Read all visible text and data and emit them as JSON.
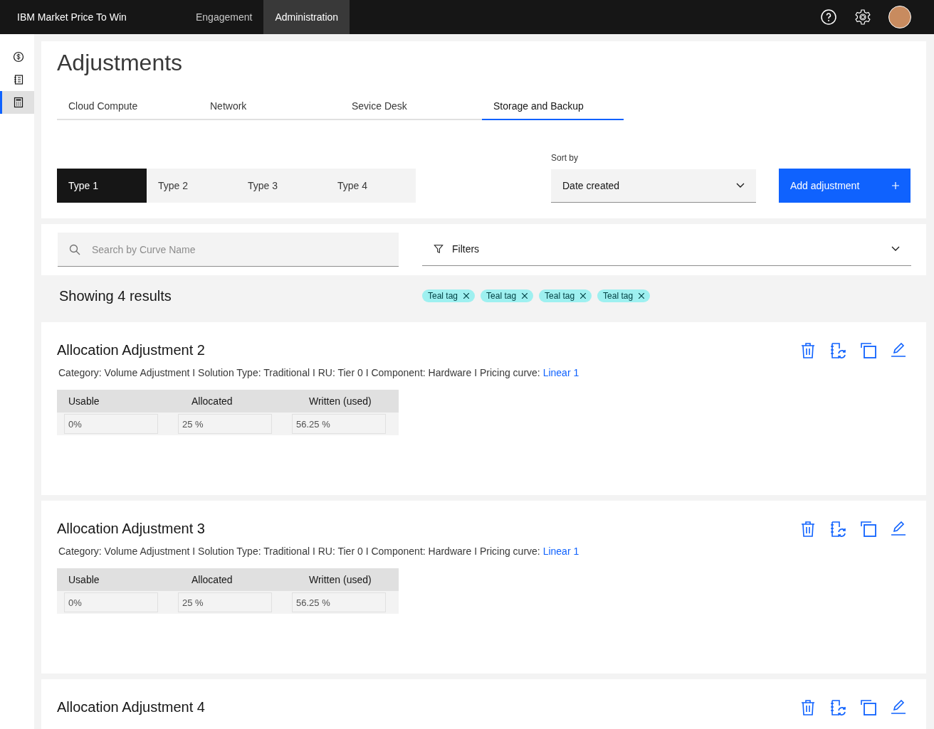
{
  "header": {
    "brand": "IBM Market Price To Win",
    "nav": [
      {
        "label": "Engagement",
        "selected": false
      },
      {
        "label": "Administration",
        "selected": true
      }
    ]
  },
  "sidebar": {
    "items": [
      {
        "kind": "dollar",
        "selected": false
      },
      {
        "kind": "notebook",
        "selected": false
      },
      {
        "kind": "calculator",
        "selected": true
      }
    ]
  },
  "page_title": "Adjustments",
  "tabs": [
    {
      "label": "Cloud Compute",
      "selected": false
    },
    {
      "label": "Network",
      "selected": false
    },
    {
      "label": "Sevice Desk",
      "selected": false
    },
    {
      "label": "Storage and Backup",
      "selected": true
    }
  ],
  "type_switcher": [
    {
      "label": "Type 1",
      "selected": true
    },
    {
      "label": "Type 2",
      "selected": false
    },
    {
      "label": "Type 3",
      "selected": false
    },
    {
      "label": "Type 4",
      "selected": false
    }
  ],
  "sort": {
    "label": "Sort by",
    "value": "Date created"
  },
  "add_button": "Add adjustment",
  "search": {
    "placeholder": "Search by Curve Name"
  },
  "filters": {
    "label": "Filters"
  },
  "results": "Showing 4 results",
  "tags": [
    "Teal tag",
    "Teal tag",
    "Teal tag",
    "Teal tag"
  ],
  "cards": [
    {
      "title": "Allocation Adjustment 2",
      "description": "Category: Volume Adjustment I Solution Type: Traditional I RU: Tier 0 I Component: Hardware I Pricing curve: ",
      "link": "Linear 1",
      "columns": [
        "Usable",
        "Allocated",
        "Written (used)"
      ],
      "values": [
        "0%",
        "25 %",
        "56.25 %"
      ]
    },
    {
      "title": "Allocation Adjustment 3",
      "description": "Category: Volume Adjustment I Solution Type: Traditional I RU: Tier 0 I Component: Hardware I Pricing curve: ",
      "link": "Linear 1",
      "columns": [
        "Usable",
        "Allocated",
        "Written (used)"
      ],
      "values": [
        "0%",
        "25 %",
        "56.25 %"
      ]
    },
    {
      "title": "Allocation Adjustment 4"
    }
  ]
}
